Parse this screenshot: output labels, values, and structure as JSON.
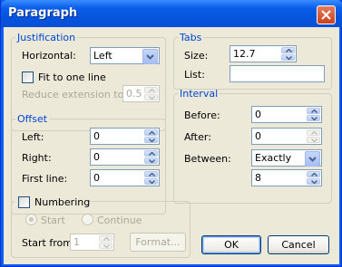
{
  "title": "Paragraph",
  "justification": {
    "legend": "Justification",
    "horizontal_label": "Horizontal:",
    "horizontal_value": "Left",
    "fit_label": "Fit to one line",
    "reduce_label": "Reduce extension to:",
    "reduce_value": "0.5"
  },
  "tabs": {
    "legend": "Tabs",
    "size_label": "Size:",
    "size_value": "12.7",
    "list_label": "List:",
    "list_value": ""
  },
  "offset": {
    "legend": "Offset",
    "left_label": "Left:",
    "left_value": "0",
    "right_label": "Right:",
    "right_value": "0",
    "first_label": "First line:",
    "first_value": "0"
  },
  "interval": {
    "legend": "Interval",
    "before_label": "Before:",
    "before_value": "0",
    "after_label": "After:",
    "after_value": "0",
    "between_label": "Between:",
    "between_value": "Exactly",
    "exact_value": "8"
  },
  "numbering": {
    "label": "Numbering",
    "start_label": "Start",
    "continue_label": "Continue",
    "start_from_label": "Start from:",
    "start_from_value": "1",
    "format_label": "Format..."
  },
  "buttons": {
    "ok": "OK",
    "cancel": "Cancel"
  },
  "colors": {
    "title_bar": "#0a5ee8",
    "dialog_bg": "#ece9d8",
    "group_label": "#0046d5",
    "close_button": "#c9411f"
  }
}
